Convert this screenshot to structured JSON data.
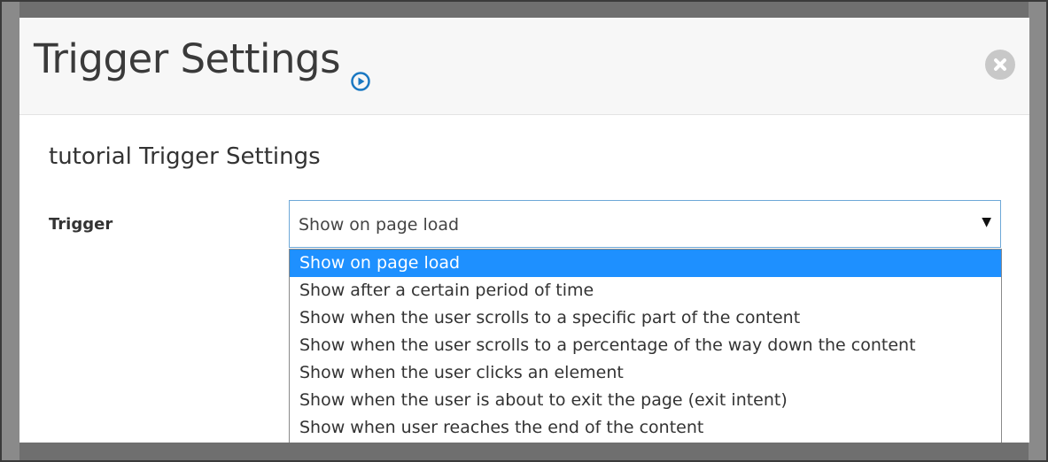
{
  "modal": {
    "title": "Trigger Settings",
    "section_title": "tutorial Trigger Settings",
    "trigger_label": "Trigger",
    "trigger_select": {
      "value": "Show on page load",
      "options": [
        "Show on page load",
        "Show after a certain period of time",
        "Show when the user scrolls to a specific part of the content",
        "Show when the user scrolls to a percentage of the way down the content",
        "Show when the user clicks an element",
        "Show when the user is about to exit the page (exit intent)",
        "Show when user reaches the end of the content"
      ],
      "selected_index": 0
    }
  },
  "colors": {
    "selected_option": "#1e90ff",
    "play_icon": "#1a78c2"
  },
  "icons": {
    "play": "play-circle-icon",
    "close": "close-circle-icon"
  }
}
